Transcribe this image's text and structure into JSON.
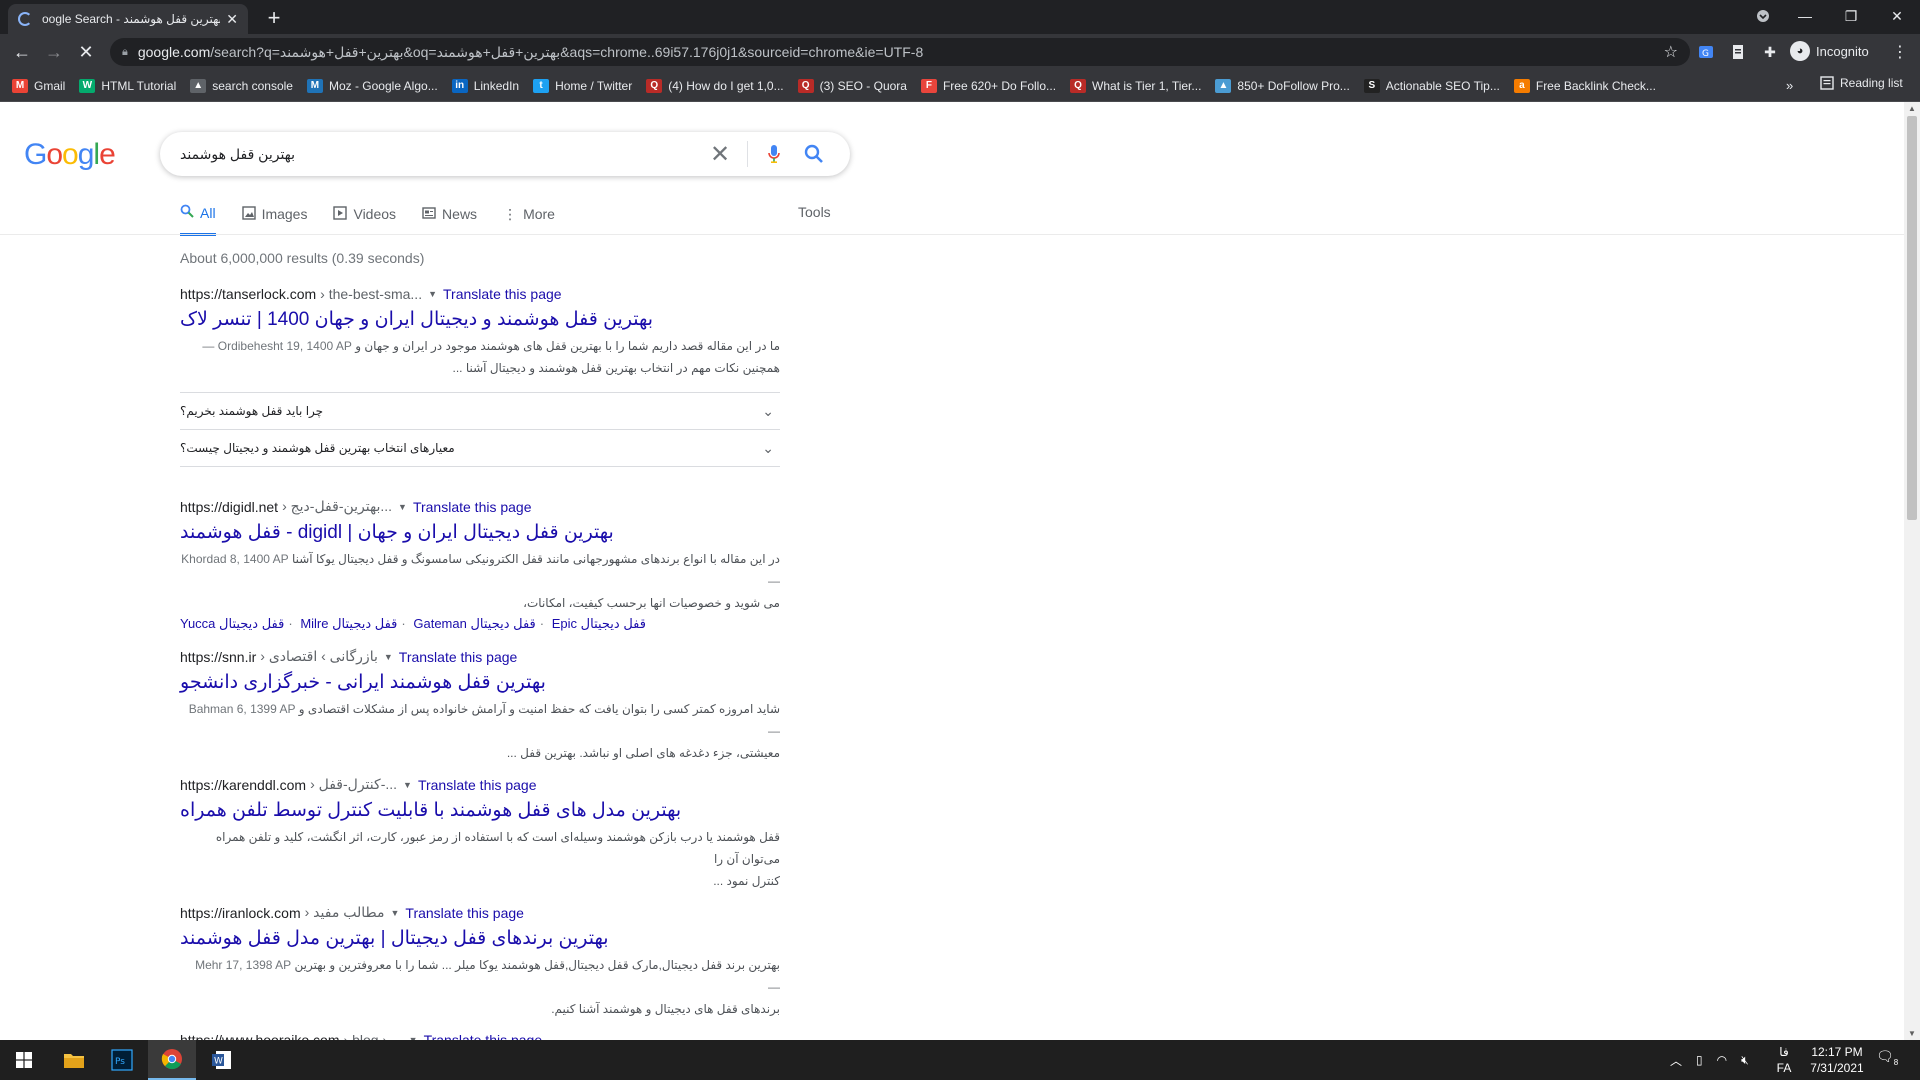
{
  "browser": {
    "tab_title": "oogle Search - بهترین قفل هوشمند",
    "url_host": "google.com",
    "url_rest": "/search?q=بهترین+قفل+هوشمند&oq=بهترین+قفل+هوشمند&aqs=chrome..69i57.176j0j1&sourceid=chrome&ie=UTF-8",
    "incognito_label": "Incognito",
    "reading_list": "Reading list",
    "bookmarks": [
      {
        "label": "Gmail",
        "icon": "M",
        "color": "#ea4335"
      },
      {
        "label": "HTML Tutorial",
        "icon": "W",
        "color": "#04aa6d"
      },
      {
        "label": "search console",
        "icon": "▲",
        "color": "#5f6368"
      },
      {
        "label": "Moz - Google Algo...",
        "icon": "M",
        "color": "#1f73b7"
      },
      {
        "label": "LinkedIn",
        "icon": "in",
        "color": "#0a66c2"
      },
      {
        "label": "Home / Twitter",
        "icon": "t",
        "color": "#1da1f2"
      },
      {
        "label": "(4) How do I get 1,0...",
        "icon": "Q",
        "color": "#b92b27"
      },
      {
        "label": "(3) SEO - Quora",
        "icon": "Q",
        "color": "#b92b27"
      },
      {
        "label": "Free 620+ Do Follo...",
        "icon": "F",
        "color": "#e8453c"
      },
      {
        "label": "What is Tier 1, Tier...",
        "icon": "Q",
        "color": "#b92b27"
      },
      {
        "label": "850+ DoFollow Pro...",
        "icon": "▲",
        "color": "#4b9cd3"
      },
      {
        "label": "Actionable SEO Tip...",
        "icon": "S",
        "color": "#222222"
      },
      {
        "label": "Free Backlink Check...",
        "icon": "a",
        "color": "#f57c00"
      }
    ]
  },
  "search": {
    "query": "بهترین قفل هوشمند",
    "stats": "About 6,000,000 results (0.39 seconds)",
    "tabs": [
      {
        "label": "All",
        "icon": "search-icon",
        "active": true
      },
      {
        "label": "Images",
        "icon": "image-icon",
        "active": false
      },
      {
        "label": "Videos",
        "icon": "play-icon",
        "active": false
      },
      {
        "label": "News",
        "icon": "news-icon",
        "active": false
      },
      {
        "label": "More",
        "icon": "dots-icon",
        "active": false
      }
    ],
    "tools": "Tools",
    "translate": "Translate this page"
  },
  "results": [
    {
      "site": "https://tanserlock.com",
      "path": "› the-best-sma...",
      "title": "بهترین قفل هوشمند و دیجیتال ایران و جهان 1400 | تنسر لاک",
      "date": "Ordibehesht 19, 1400 AP —",
      "snippet1": "ما در این مقاله قصد داریم شما را با بهترین قفل های هوشمند موجود در ایران و جهان و",
      "snippet2": "همچنین نکات مهم در انتخاب بهترین قفل هوشمند و دیجیتال آشنا ..."
    },
    {
      "site": "https://digidl.net",
      "path": "› بهترین-قفل-دیج...",
      "title": "بهترین قفل دیجیتال ایران و جهان | digidl - قفل هوشمند",
      "date": "Khordad 8, 1400 AP —",
      "snippet1": "در این مقاله با انواع برندهای مشهورجهانی مانند قفل الکترونیکی سامسونگ و قفل دیجیتال یوکا آشنا",
      "snippet2": "می شوید و خصوصیات انها برحسب کیفیت، امکانات،",
      "sitelinks": [
        "Yucca قفل دیجیتال",
        "Milre قفل دیجیتال",
        "Gateman قفل دیجیتال",
        "Epic قفل دیجیتال"
      ]
    },
    {
      "site": "https://snn.ir",
      "path": "› بازرگانی › اقتصادی",
      "title": "بهترین قفل هوشمند ایرانی - خبرگزاری دانشجو",
      "date": "Bahman 6, 1399 AP —",
      "snippet1": "شاید امروزه کمتر کسی را بتوان یافت که حفظ امنیت و آرامش خانواده پس از مشکلات اقتصادی و",
      "snippet2": "معیشتی، جزء دغدغه های اصلی او نباشد. بهترین قفل ..."
    },
    {
      "site": "https://karenddl.com",
      "path": "› کنترل-قفل-...",
      "title": "بهترین مدل های قفل هوشمند با قابلیت کنترل توسط تلفن همراه",
      "date": "",
      "snippet1": "قفل هوشمند یا درب بازکن هوشمند وسیله‌ای است که با استفاده از رمز عبور، کارت، اثر انگشت، کلید و تلفن همراه می‌توان آن را",
      "snippet2": "کنترل نمود ..."
    },
    {
      "site": "https://iranlock.com",
      "path": "› مطالب مفید",
      "title": "بهترین برندهای قفل دیجیتال | بهترین مدل قفل هوشمند",
      "date": "Mehr 17, 1398 AP —",
      "snippet1": "بهترین برند قفل دیجیتال,مارک قفل دیجیتال,قفل هوشمند یوکا میلر ... شما را با معروفترین و بهترین",
      "snippet2": "برندهای قفل های دیجیتال و هوشمند آشنا کنیم."
    }
  ],
  "faq": [
    "چرا باید قفل هوشمند بخریم؟",
    "معیارهای انتخاب بهترین قفل هوشمند و دیجیتال چیست؟"
  ],
  "partial_result": {
    "site": "https://www.hooraiko.com",
    "path": "› blog › ...",
    "translate": "Translate this page"
  },
  "taskbar": {
    "time": "12:17 PM",
    "date": "7/31/2021",
    "lang_top": "فا",
    "lang_bottom": "FA",
    "notif_count": "8"
  }
}
